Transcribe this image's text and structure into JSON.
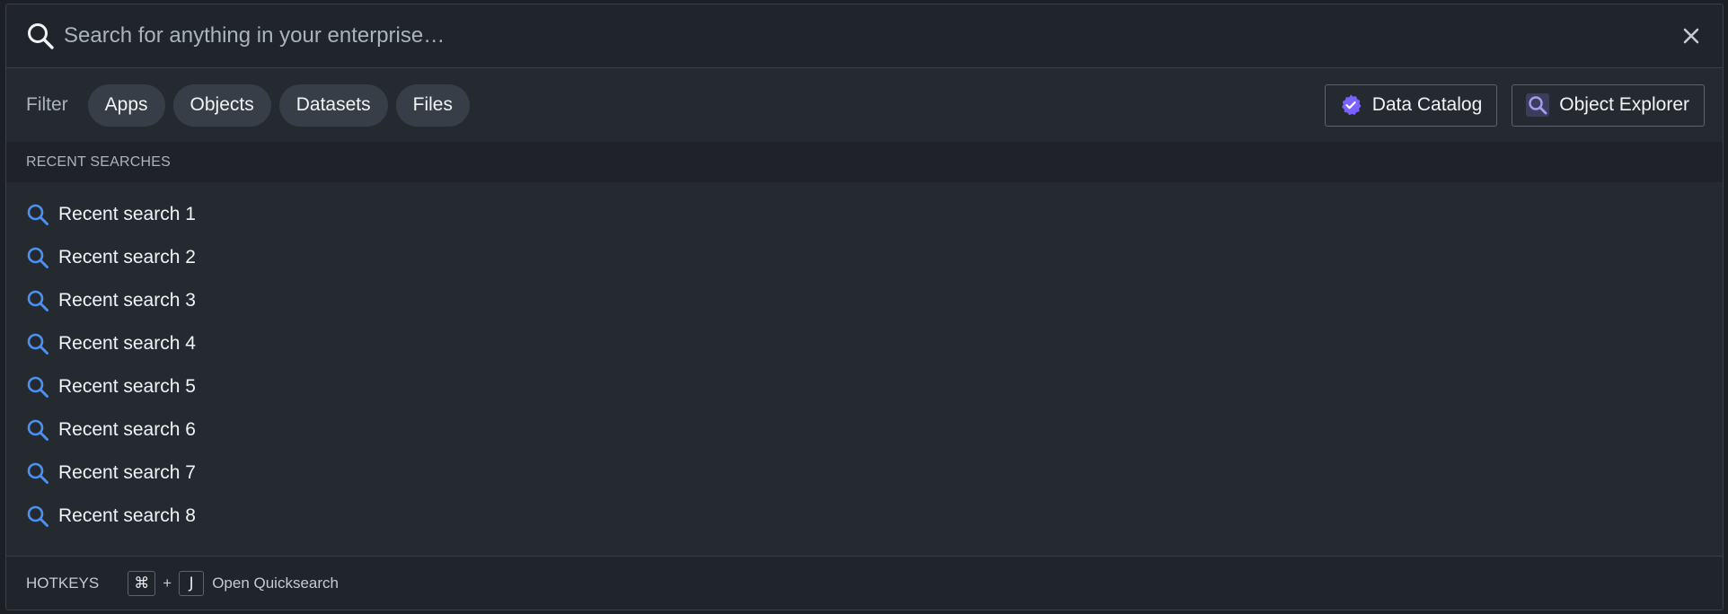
{
  "search": {
    "placeholder": "Search for anything in your enterprise…",
    "icon": "search-icon",
    "close_icon": "close-icon"
  },
  "filter": {
    "label": "Filter",
    "chips": [
      {
        "label": "Apps"
      },
      {
        "label": "Objects"
      },
      {
        "label": "Datasets"
      },
      {
        "label": "Files"
      }
    ]
  },
  "apps": {
    "data_catalog": {
      "label": "Data Catalog",
      "icon": "verified-badge-icon",
      "color": "#7b61ff"
    },
    "object_explorer": {
      "label": "Object Explorer",
      "icon": "object-explorer-icon",
      "color": "#8a7fd6"
    }
  },
  "recent": {
    "header": "RECENT SEARCHES",
    "items": [
      {
        "label": "Recent search 1"
      },
      {
        "label": "Recent search 2"
      },
      {
        "label": "Recent search 3"
      },
      {
        "label": "Recent search 4"
      },
      {
        "label": "Recent search 5"
      },
      {
        "label": "Recent search 6"
      },
      {
        "label": "Recent search 7"
      },
      {
        "label": "Recent search 8"
      }
    ],
    "icon_color": "#4c90f0"
  },
  "footer": {
    "hotkeys_label": "HOTKEYS",
    "key1": "⌘",
    "plus": "+",
    "key2": "J",
    "description": "Open Quicksearch"
  }
}
